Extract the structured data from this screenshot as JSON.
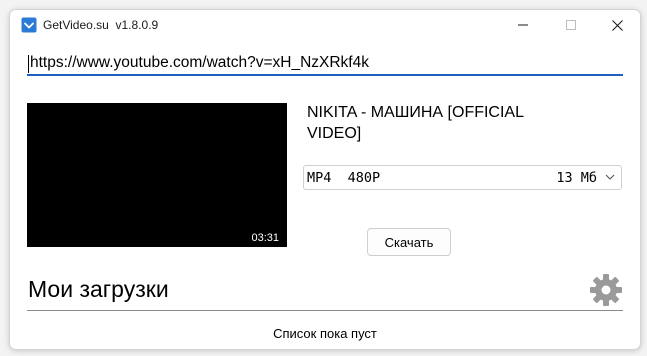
{
  "window": {
    "app_name": "GetVideo.su",
    "version": "v1.8.0.9"
  },
  "url_input": {
    "value": "https://www.youtube.com/watch?v=xH_NzXRkf4k"
  },
  "video": {
    "title": "NIKITA - МАШИНА [OFFICIAL VIDEO]",
    "duration": "03:31"
  },
  "format": {
    "selected_format": "MP4  480P",
    "selected_size": "13 Мб"
  },
  "download_button": {
    "label": "Скачать"
  },
  "downloads": {
    "title": "Мои загрузки",
    "empty_text": "Список пока пуст"
  },
  "colors": {
    "accent": "#1f5fbf",
    "app_icon": "#2b7bd6",
    "gear": "#9a9a9a"
  }
}
